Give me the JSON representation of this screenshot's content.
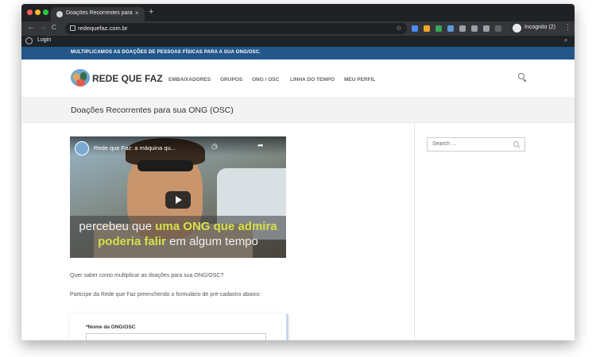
{
  "browser": {
    "tab_title": "Doações Recorrentes para sua ONG (OSC)",
    "tab_close": "×",
    "new_tab": "+",
    "nav_back": "←",
    "nav_forward": "→",
    "nav_reload": "C",
    "url": "redequefaz.com.br",
    "star": "☆",
    "incognito_label": "Incognito (2)",
    "menu": "⋮",
    "traffic_colors": [
      "#ff5f57",
      "#febc2e",
      "#28c840"
    ],
    "extension_colors": [
      "#4c8bf5",
      "#f5a623",
      "#34a853",
      "#5b9bd5",
      "#9aa0a6",
      "#9aa0a6",
      "#9aa0a6",
      "#9aa0a6"
    ]
  },
  "admin_bar": {
    "login": "Login",
    "search_icon": "⌕"
  },
  "top_bar": {
    "text": "MULTIPLICAMOS AS DOAÇÕES DE PESSOAS FÍSICAS PARA A SUA ONG/OSC."
  },
  "header": {
    "site_title": "REDE QUE FAZ",
    "nav": [
      "EMBAIXADORES",
      "GRUPOS",
      "ONG / OSC",
      "LINHA DO TEMPO",
      "MEU PERFIL"
    ]
  },
  "page": {
    "title": "Doações Recorrentes para sua ONG (OSC)"
  },
  "video": {
    "title": "Rede que Faz: a máquina qu...",
    "clock_icon": "◷",
    "share_icon": "➦",
    "caption_pre": "percebeu que ",
    "caption_hl1": "uma ONG que admira",
    "caption_hl2": "poderia falir",
    "caption_post": " em algum tempo"
  },
  "content": {
    "paragraph1": "Quer saber como multiplicar as doações para sua ONG/OSC?",
    "paragraph2": "Participe da Rede que Faz preenchendo o formulário de pré-cadastro abaixo:"
  },
  "form": {
    "name_label": "*Nome da ONG/OSC"
  },
  "sidebar": {
    "search_placeholder": "Search …"
  }
}
